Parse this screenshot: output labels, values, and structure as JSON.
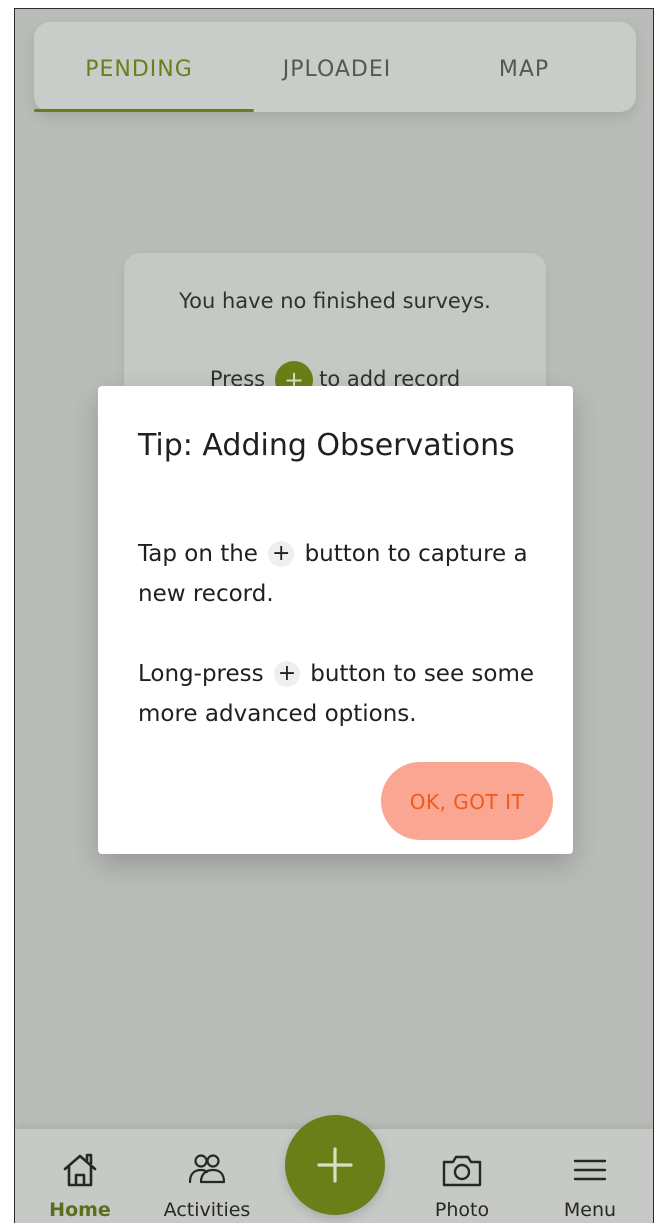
{
  "tabs": {
    "items": [
      {
        "label": "PENDING"
      },
      {
        "label": "JPLOADEI"
      },
      {
        "label": "MAP"
      }
    ],
    "active_index": 0
  },
  "empty_state": {
    "message": "You have no finished surveys.",
    "press_prefix": "Press",
    "press_suffix": "to add record",
    "plus_glyph": "+"
  },
  "dialog": {
    "title": "Tip: Adding Observations",
    "paragraph1": {
      "before": "Tap on the",
      "plus": "+",
      "after": "button to capture a new record."
    },
    "paragraph2": {
      "before": "Long-press",
      "plus": "+",
      "after": "button to see some more advanced options."
    },
    "ok_button": "OK, GOT IT"
  },
  "bottom_nav": {
    "items": [
      {
        "label": "Home",
        "icon": "home-icon"
      },
      {
        "label": "Activities",
        "icon": "people-icon"
      },
      {
        "label": "Photo",
        "icon": "camera-icon"
      },
      {
        "label": "Menu",
        "icon": "menu-icon"
      }
    ],
    "fab_icon": "plus-icon"
  },
  "colors": {
    "accent": "#6a7f17",
    "overlay_background": "#b9bcb8",
    "dialog_background": "#ffffff",
    "ok_button_background": "#fba693",
    "ok_button_text": "#ef5a1a"
  }
}
